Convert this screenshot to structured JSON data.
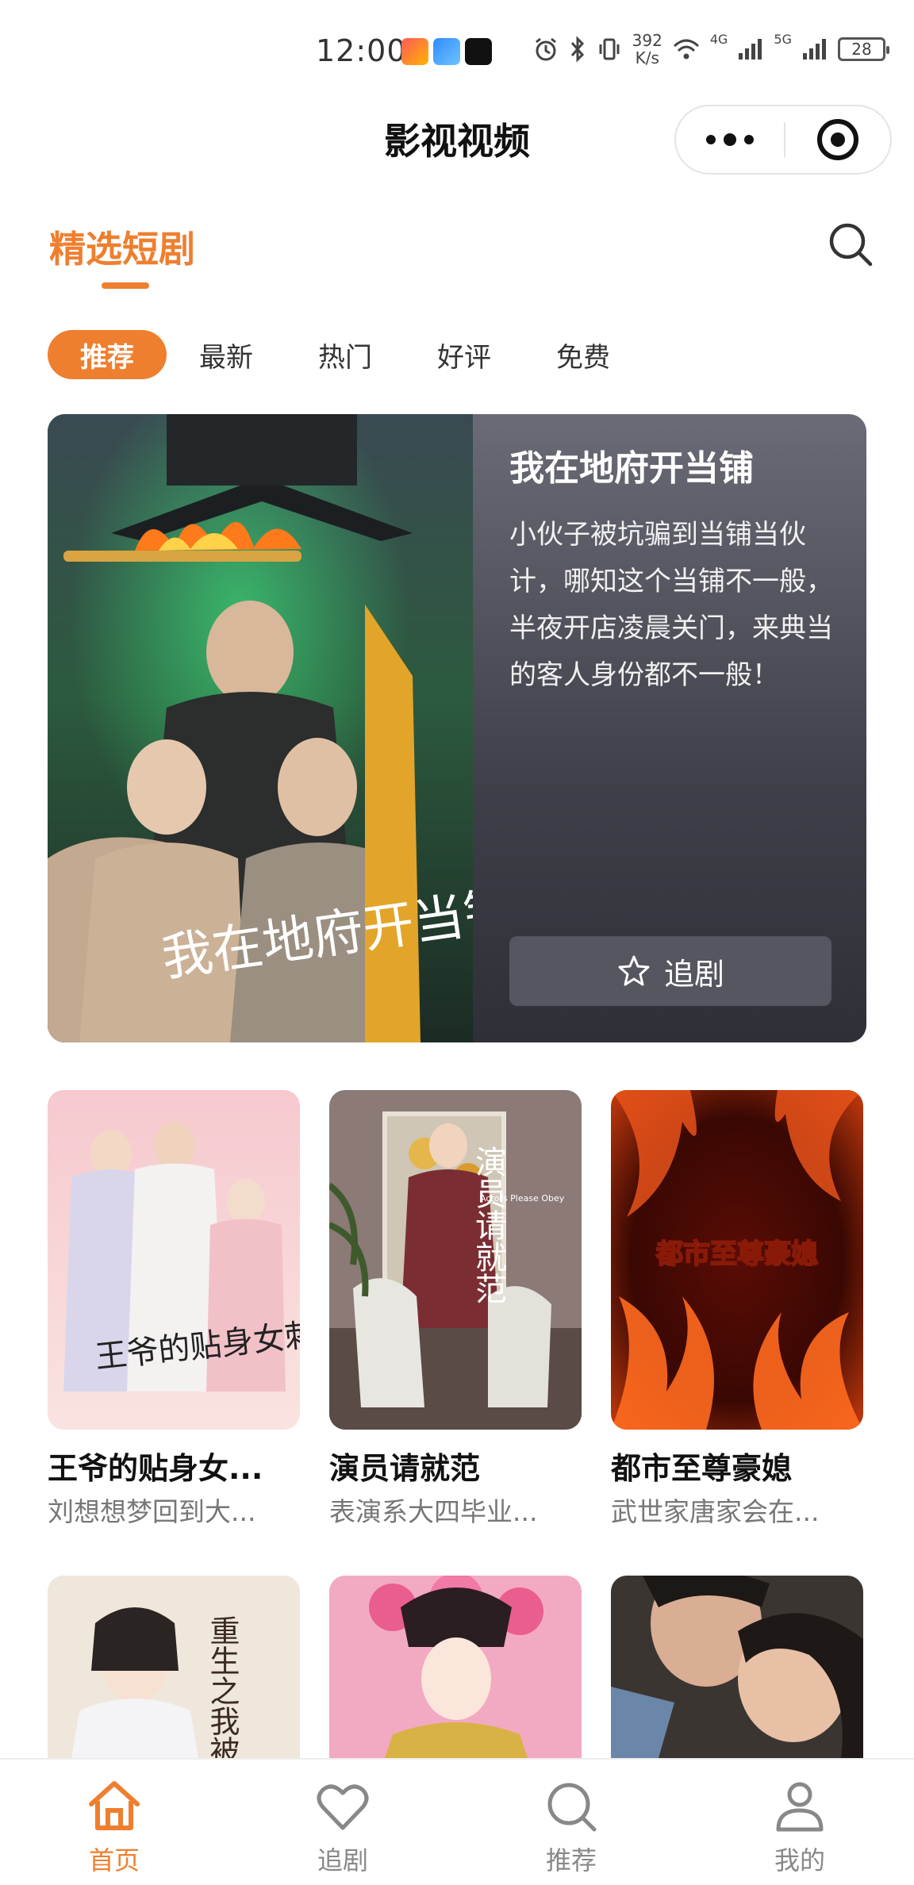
{
  "status_bar": {
    "time": "12:00",
    "speed_value": "392",
    "speed_unit": "K/s",
    "net1": "4G",
    "net2": "5G",
    "battery": "28"
  },
  "app": {
    "title": "影视视频"
  },
  "section": {
    "title": "精选短剧",
    "accent_color": "#ee7f2f"
  },
  "chips": [
    {
      "label": "推荐",
      "active": true
    },
    {
      "label": "最新",
      "active": false
    },
    {
      "label": "热门",
      "active": false
    },
    {
      "label": "好评",
      "active": false
    },
    {
      "label": "免费",
      "active": false
    }
  ],
  "featured": {
    "title": "我在地府开当铺",
    "description": "小伙子被坑骗到当铺当伙计，哪知这个当铺不一般，半夜开店凌晨关门，来典当的客人身份都不一般！",
    "poster_text": "我在地府开当铺",
    "follow_label": "追剧"
  },
  "grid": [
    {
      "title": "王爷的贴身女...",
      "desc": "刘想想梦回到大...",
      "poster_text": "王爷的贴身女刺客"
    },
    {
      "title": "演员请就范",
      "desc": "表演系大四毕业...",
      "poster_text": "演员请就范",
      "poster_sub": "Actors Please Obey"
    },
    {
      "title": "都市至尊豪媳",
      "desc": "武世家唐家会在...",
      "poster_text": "都市至尊豪媳"
    },
    {
      "poster_text": "重生之我被选妃"
    },
    {},
    {}
  ],
  "tabbar": [
    {
      "label": "首页",
      "icon": "home-icon",
      "active": true
    },
    {
      "label": "追剧",
      "icon": "heart-icon",
      "active": false
    },
    {
      "label": "推荐",
      "icon": "search-icon",
      "active": false
    },
    {
      "label": "我的",
      "icon": "user-icon",
      "active": false
    }
  ]
}
